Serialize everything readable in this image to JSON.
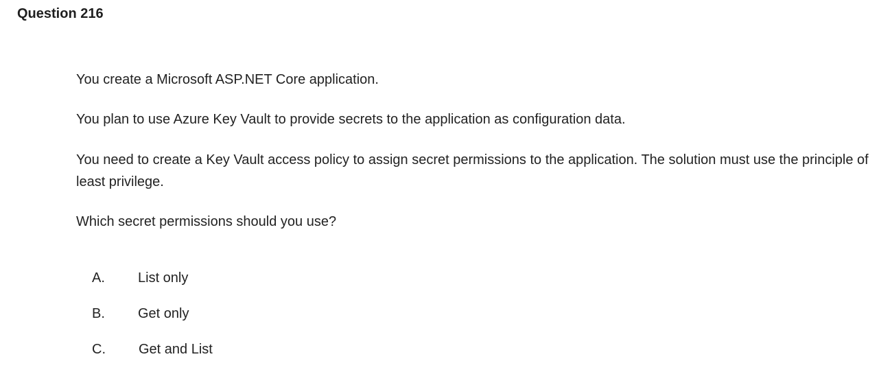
{
  "question": {
    "title": "Question 216",
    "paragraphs": [
      "You create a Microsoft ASP.NET Core application.",
      "You plan to use Azure Key Vault to provide secrets to the application as configuration data.",
      "You need to create a Key Vault access policy to assign secret permissions to the application. The solution must use the principle of least privilege.",
      "Which secret permissions should you use?"
    ],
    "options": [
      {
        "letter": "A.",
        "text": "List only"
      },
      {
        "letter": "B.",
        "text": "Get only"
      },
      {
        "letter": "C.",
        "text": "Get and List"
      }
    ]
  }
}
